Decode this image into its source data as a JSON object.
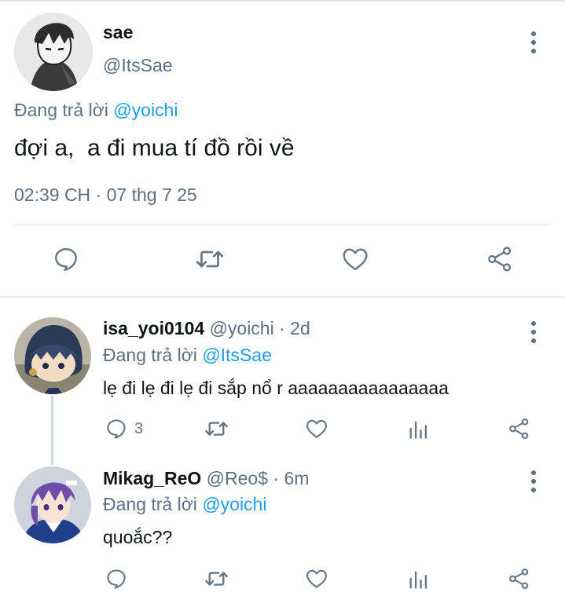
{
  "main_tweet": {
    "display_name": "sae",
    "handle": "@ItsSae",
    "reply_prefix": "Đang trả lời",
    "reply_to": "@yoichi",
    "text": "đợi a,  a đi mua tí đồ rồi về",
    "timestamp": "02:39 CH · 07 thg 7 25"
  },
  "replies": [
    {
      "display_name": "isa_yoi0104",
      "handle": "@yoichi",
      "time": "· 2d",
      "reply_prefix": "Đang trả lời",
      "reply_to": "@ItsSae",
      "text": "lẹ đi lẹ đi lẹ đi sắp nổ r aaaaaaaaaaaaaaaa",
      "reply_count": "3"
    },
    {
      "display_name": "Mikag_ReO",
      "handle": "@Reo$",
      "time": "· 6m",
      "reply_prefix": "Đang trả lời",
      "reply_to": "@yoichi",
      "text": "quoắc??",
      "reply_count": ""
    }
  ],
  "colors": {
    "link": "#1d9bf0",
    "muted": "#5b7083",
    "icon": "#657786",
    "divider": "#e1e6ea"
  }
}
